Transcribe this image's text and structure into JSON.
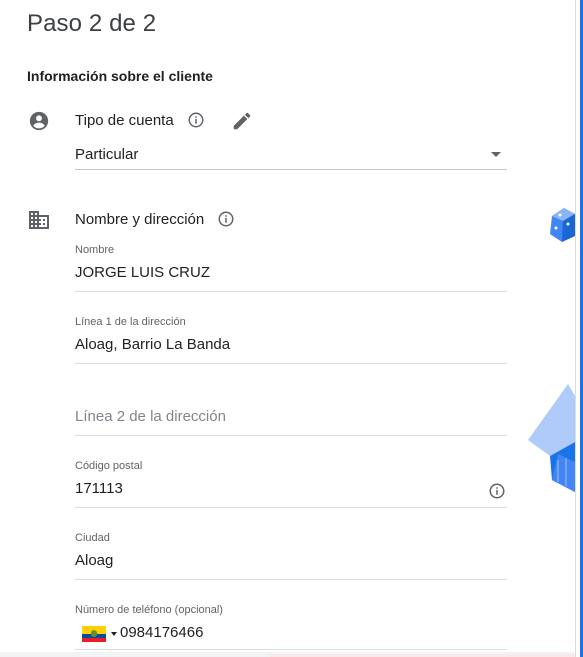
{
  "page": {
    "title": "Paso 2 de 2",
    "section_title": "Información sobre el cliente"
  },
  "account_type": {
    "label": "Tipo de cuenta",
    "value": "Particular",
    "icon": "account-circle-icon",
    "info_icon": "info-icon",
    "edit_icon": "pencil-icon"
  },
  "address": {
    "label": "Nombre y dirección",
    "icon": "building-icon",
    "info_icon": "info-icon",
    "fields": {
      "name": {
        "label": "Nombre",
        "value": "JORGE LUIS CRUZ"
      },
      "line1": {
        "label": "Línea 1 de la dirección",
        "value": "Aloag, Barrio La Banda"
      },
      "line2": {
        "placeholder": "Línea 2 de la dirección"
      },
      "postal": {
        "label": "Código postal",
        "value": "171113"
      },
      "city": {
        "label": "Ciudad",
        "value": "Aloag"
      },
      "phone": {
        "label": "Número de teléfono (opcional)",
        "value": "0984176466",
        "country": "Ecuador"
      }
    }
  },
  "colors": {
    "accent": "#1a73e8",
    "text": "#202124",
    "muted": "#5f6368"
  }
}
